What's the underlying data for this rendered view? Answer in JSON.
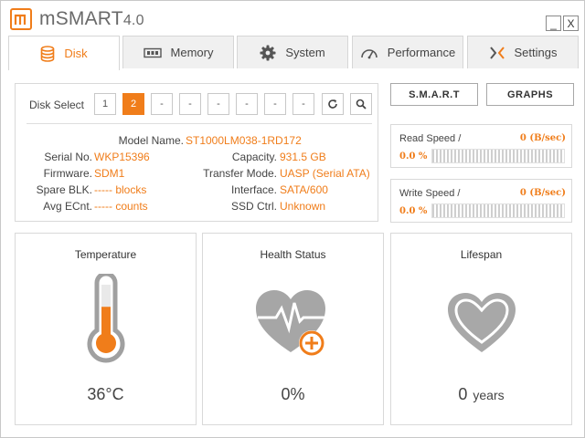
{
  "app": {
    "title": "mSMART",
    "version": "4.0",
    "minimize_label": "_",
    "close_label": "X"
  },
  "colors": {
    "accent": "#f07d1a",
    "muted": "#a0a0a0"
  },
  "tabs": [
    {
      "label": "Disk",
      "icon": "disk-icon",
      "active": true
    },
    {
      "label": "Memory",
      "icon": "memory-icon",
      "active": false
    },
    {
      "label": "System",
      "icon": "gear-icon",
      "active": false
    },
    {
      "label": "Performance",
      "icon": "gauge-icon",
      "active": false
    },
    {
      "label": "Settings",
      "icon": "settings-icon",
      "active": false
    }
  ],
  "disk_select": {
    "label": "Disk Select",
    "buttons": [
      "1",
      "2",
      "-",
      "-",
      "-",
      "-",
      "-",
      "-"
    ],
    "active_index": 1
  },
  "disk_info": {
    "model_name_label": "Model Name.",
    "model_name": "ST1000LM038-1RD172",
    "serial_label": "Serial No.",
    "serial": "WKP15396",
    "firmware_label": "Firmware.",
    "firmware": "SDM1",
    "spare_label": "Spare BLK.",
    "spare": "----- blocks",
    "avg_label": "Avg ECnt.",
    "avg": "----- counts",
    "capacity_label": "Capacity.",
    "capacity": "931.5 GB",
    "transfer_label": "Transfer Mode.",
    "transfer": "UASP (Serial ATA)",
    "interface_label": "Interface.",
    "interface": "SATA/600",
    "ssd_label": "SSD Ctrl.",
    "ssd": "Unknown"
  },
  "buttons": {
    "smart": "S.M.A.R.T",
    "graphs": "GRAPHS"
  },
  "read_speed": {
    "label": "Read Speed /",
    "value": "0 (B/sec)",
    "percent_text": "0.0 %",
    "percent": 0
  },
  "write_speed": {
    "label": "Write Speed /",
    "value": "0 (B/sec)",
    "percent_text": "0.0 %",
    "percent": 0
  },
  "temperature": {
    "title": "Temperature",
    "value": "36°C",
    "level": 0.36
  },
  "health": {
    "title": "Health Status",
    "value": "0%"
  },
  "lifespan": {
    "title": "Lifespan",
    "value": "0",
    "unit": "years"
  }
}
